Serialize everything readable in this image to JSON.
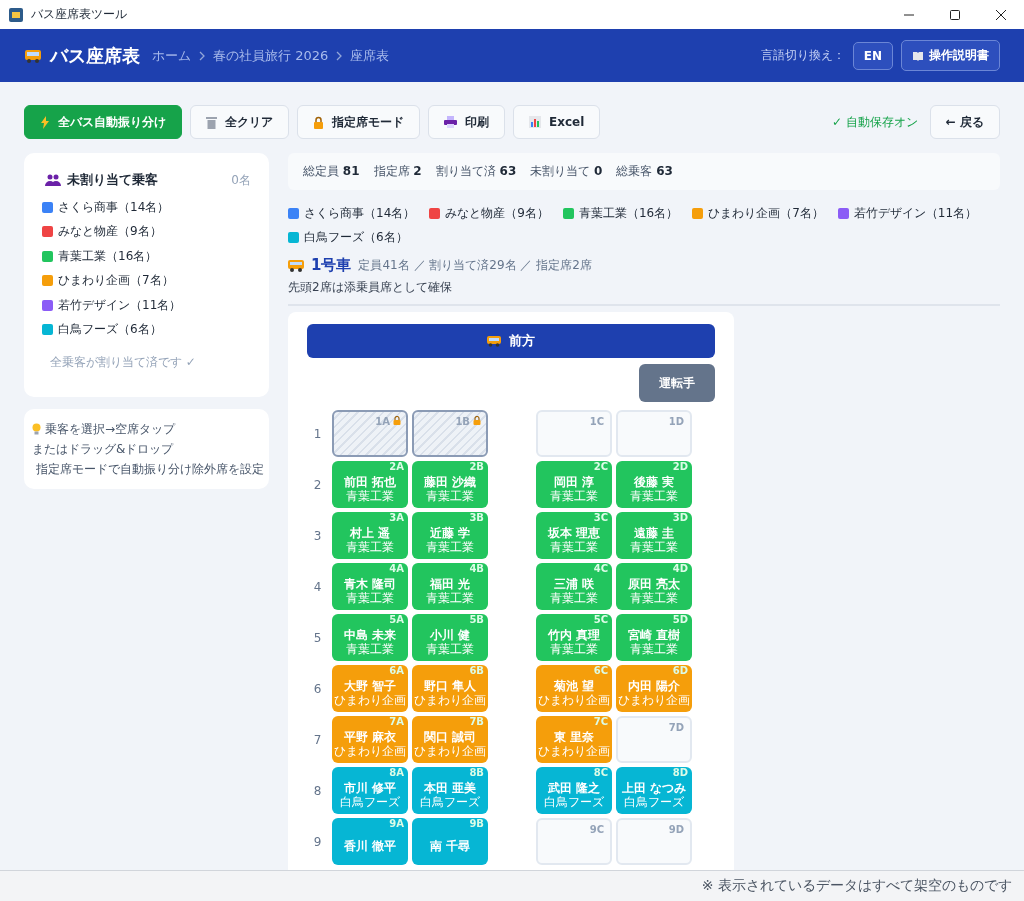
{
  "window": {
    "title": "バス座席表ツール"
  },
  "header": {
    "title": "バス座席表",
    "breadcrumb": [
      "ホーム",
      "春の社員旅行 2026",
      "座席表"
    ],
    "language_label": "言語切り換え：",
    "language_button": "EN",
    "manual_button": "操作説明書"
  },
  "toolbar": {
    "buttons": [
      {
        "label": "全バス自動振り分け",
        "kind": "primary"
      },
      {
        "label": "全クリア",
        "kind": "default"
      },
      {
        "label": "指定席モード",
        "kind": "default"
      },
      {
        "label": "印刷",
        "kind": "default"
      },
      {
        "label": "Excel",
        "kind": "default"
      }
    ],
    "autosave": "✓ 自動保存オン",
    "back_button": "← 戻る"
  },
  "sidebar": {
    "title": "未割り当て乗客",
    "count": "0名",
    "companies": [
      {
        "label": "さくら商事（14名）",
        "color": "#3b82f6"
      },
      {
        "label": "みなと物産（9名）",
        "color": "#ef4444"
      },
      {
        "label": "青葉工業（16名）",
        "color": "#22c55e"
      },
      {
        "label": "ひまわり企画（7名）",
        "color": "#f59e0b"
      },
      {
        "label": "若竹デザイン（11名）",
        "color": "#8b5cf6"
      },
      {
        "label": "白鳥フーズ（6名）",
        "color": "#06b6d4"
      }
    ],
    "done_message": "全乗客が割り当て済です ✓",
    "tips": [
      "乗客を選択→空席タップ",
      "またはドラッグ&ドロップ",
      "指定席モードで自動振り分け除外席を設定"
    ]
  },
  "stats": [
    {
      "label": "総定員",
      "value": "81"
    },
    {
      "label": "指定席",
      "value": "2"
    },
    {
      "label": "割り当て済",
      "value": "63"
    },
    {
      "label": "未割り当て",
      "value": "0"
    },
    {
      "label": "総乗客",
      "value": "63"
    }
  ],
  "legend": [
    {
      "label": "さくら商事（14名）",
      "color": "#3b82f6"
    },
    {
      "label": "みなと物産（9名）",
      "color": "#ef4444"
    },
    {
      "label": "青葉工業（16名）",
      "color": "#22c55e"
    },
    {
      "label": "ひまわり企画（7名）",
      "color": "#f59e0b"
    },
    {
      "label": "若竹デザイン（11名）",
      "color": "#8b5cf6"
    },
    {
      "label": "白鳥フーズ（6名）",
      "color": "#06b6d4"
    }
  ],
  "bus": {
    "name": "1号車",
    "info": "定員41名 ／ 割り当て済29名 ／ 指定席2席",
    "note": "先頭2席は添乗員席として確保",
    "front_label": "前方",
    "driver_label": "運転手",
    "rows": [
      {
        "number": "1",
        "seats": [
          {
            "id": "1A",
            "kind": "reserved"
          },
          {
            "id": "1B",
            "kind": "reserved"
          },
          {
            "id": "1C",
            "kind": "empty"
          },
          {
            "id": "1D",
            "kind": "empty"
          }
        ]
      },
      {
        "number": "2",
        "seats": [
          {
            "id": "2A",
            "kind": "passenger",
            "name": "前田 拓也",
            "company": "青葉工業",
            "color": "#22c55e"
          },
          {
            "id": "2B",
            "kind": "passenger",
            "name": "藤田 沙織",
            "company": "青葉工業",
            "color": "#22c55e"
          },
          {
            "id": "2C",
            "kind": "passenger",
            "name": "岡田 淳",
            "company": "青葉工業",
            "color": "#22c55e"
          },
          {
            "id": "2D",
            "kind": "passenger",
            "name": "後藤 実",
            "company": "青葉工業",
            "color": "#22c55e"
          }
        ]
      },
      {
        "number": "3",
        "seats": [
          {
            "id": "3A",
            "kind": "passenger",
            "name": "村上 遥",
            "company": "青葉工業",
            "color": "#22c55e"
          },
          {
            "id": "3B",
            "kind": "passenger",
            "name": "近藤 学",
            "company": "青葉工業",
            "color": "#22c55e"
          },
          {
            "id": "3C",
            "kind": "passenger",
            "name": "坂本 理恵",
            "company": "青葉工業",
            "color": "#22c55e"
          },
          {
            "id": "3D",
            "kind": "passenger",
            "name": "遠藤 圭",
            "company": "青葉工業",
            "color": "#22c55e"
          }
        ]
      },
      {
        "number": "4",
        "seats": [
          {
            "id": "4A",
            "kind": "passenger",
            "name": "青木 隆司",
            "company": "青葉工業",
            "color": "#22c55e"
          },
          {
            "id": "4B",
            "kind": "passenger",
            "name": "福田 光",
            "company": "青葉工業",
            "color": "#22c55e"
          },
          {
            "id": "4C",
            "kind": "passenger",
            "name": "三浦 咲",
            "company": "青葉工業",
            "color": "#22c55e"
          },
          {
            "id": "4D",
            "kind": "passenger",
            "name": "原田 亮太",
            "company": "青葉工業",
            "color": "#22c55e"
          }
        ]
      },
      {
        "number": "5",
        "seats": [
          {
            "id": "5A",
            "kind": "passenger",
            "name": "中島 未来",
            "company": "青葉工業",
            "color": "#22c55e"
          },
          {
            "id": "5B",
            "kind": "passenger",
            "name": "小川 健",
            "company": "青葉工業",
            "color": "#22c55e"
          },
          {
            "id": "5C",
            "kind": "passenger",
            "name": "竹内 真理",
            "company": "青葉工業",
            "color": "#22c55e"
          },
          {
            "id": "5D",
            "kind": "passenger",
            "name": "宮崎 直樹",
            "company": "青葉工業",
            "color": "#22c55e"
          }
        ]
      },
      {
        "number": "6",
        "seats": [
          {
            "id": "6A",
            "kind": "passenger",
            "name": "大野 智子",
            "company": "ひまわり企画",
            "color": "#f59e0b"
          },
          {
            "id": "6B",
            "kind": "passenger",
            "name": "野口 隼人",
            "company": "ひまわり企画",
            "color": "#f59e0b"
          },
          {
            "id": "6C",
            "kind": "passenger",
            "name": "菊池 望",
            "company": "ひまわり企画",
            "color": "#f59e0b"
          },
          {
            "id": "6D",
            "kind": "passenger",
            "name": "内田 陽介",
            "company": "ひまわり企画",
            "color": "#f59e0b"
          }
        ]
      },
      {
        "number": "7",
        "seats": [
          {
            "id": "7A",
            "kind": "passenger",
            "name": "平野 麻衣",
            "company": "ひまわり企画",
            "color": "#f59e0b"
          },
          {
            "id": "7B",
            "kind": "passenger",
            "name": "関口 誠司",
            "company": "ひまわり企画",
            "color": "#f59e0b"
          },
          {
            "id": "7C",
            "kind": "passenger",
            "name": "東 里奈",
            "company": "ひまわり企画",
            "color": "#f59e0b"
          },
          {
            "id": "7D",
            "kind": "empty"
          }
        ]
      },
      {
        "number": "8",
        "seats": [
          {
            "id": "8A",
            "kind": "passenger",
            "name": "市川 修平",
            "company": "白鳥フーズ",
            "color": "#06b6d4"
          },
          {
            "id": "8B",
            "kind": "passenger",
            "name": "本田 亜美",
            "company": "白鳥フーズ",
            "color": "#06b6d4"
          },
          {
            "id": "8C",
            "kind": "passenger",
            "name": "武田 隆之",
            "company": "白鳥フーズ",
            "color": "#06b6d4"
          },
          {
            "id": "8D",
            "kind": "passenger",
            "name": "上田 なつみ",
            "company": "白鳥フーズ",
            "color": "#06b6d4"
          }
        ]
      },
      {
        "number": "9",
        "seats": [
          {
            "id": "9A",
            "kind": "passenger",
            "name": "香川 徹平",
            "color": "#06b6d4"
          },
          {
            "id": "9B",
            "kind": "passenger",
            "name": "南 千尋",
            "color": "#06b6d4"
          },
          {
            "id": "9C",
            "kind": "empty"
          },
          {
            "id": "9D",
            "kind": "empty"
          }
        ]
      }
    ]
  },
  "footer": {
    "note": "※ 表示されているデータはすべて架空のものです"
  }
}
